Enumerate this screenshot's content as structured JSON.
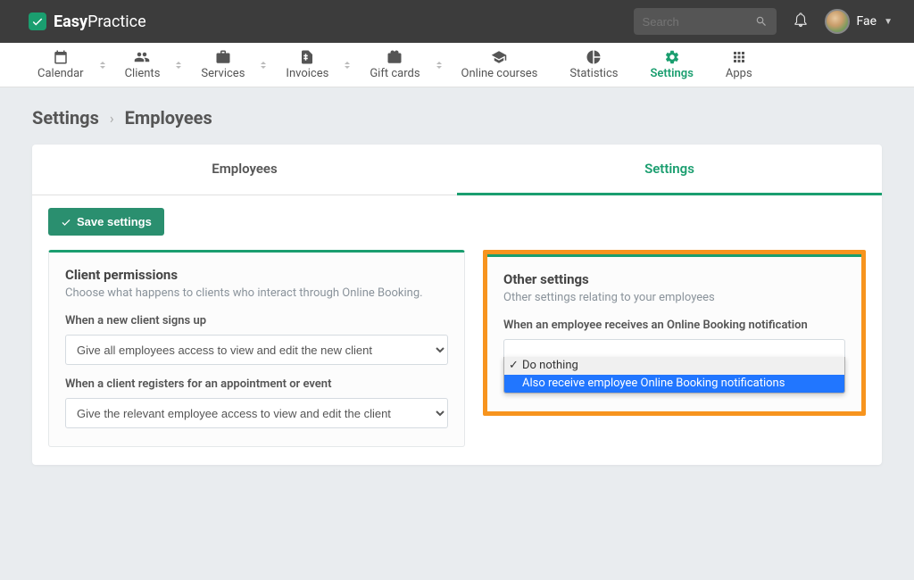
{
  "brand": {
    "bold": "Easy",
    "light": "Practice"
  },
  "search": {
    "placeholder": "Search"
  },
  "user": {
    "name": "Fae"
  },
  "nav": [
    {
      "label": "Calendar"
    },
    {
      "label": "Clients"
    },
    {
      "label": "Services"
    },
    {
      "label": "Invoices"
    },
    {
      "label": "Gift cards"
    },
    {
      "label": "Online courses"
    },
    {
      "label": "Statistics"
    },
    {
      "label": "Settings"
    },
    {
      "label": "Apps"
    }
  ],
  "breadcrumb": {
    "root": "Settings",
    "current": "Employees"
  },
  "tabs": {
    "employees": "Employees",
    "settings": "Settings"
  },
  "save_button": "Save settings",
  "client_perms": {
    "title": "Client permissions",
    "desc": "Choose what happens to clients who interact through Online Booking.",
    "field1_label": "When a new client signs up",
    "field1_value": "Give all employees access to view and edit the new client",
    "field2_label": "When a client registers for an appointment or event",
    "field2_value": "Give the relevant employee access to view and edit the client"
  },
  "other": {
    "title": "Other settings",
    "desc": "Other settings relating to your employees",
    "field1_label": "When an employee receives an Online Booking notification",
    "option1": "Do nothing",
    "option2": "Also receive employee Online Booking notifications"
  }
}
